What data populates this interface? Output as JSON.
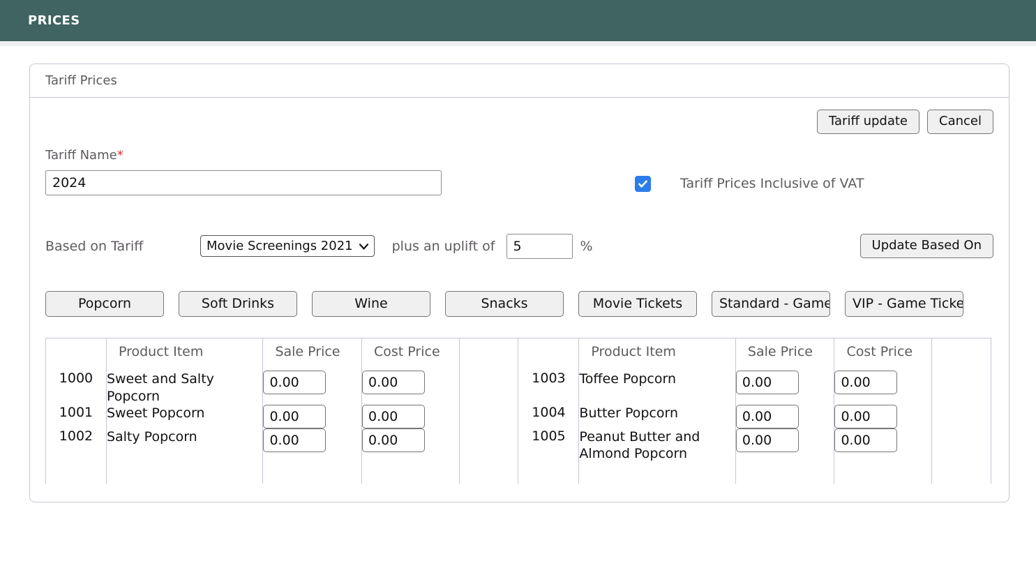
{
  "appbar": {
    "title": "PRICES"
  },
  "panel": {
    "title": "Tariff Prices"
  },
  "toolbar": {
    "tariff_update_label": "Tariff update",
    "cancel_label": "Cancel"
  },
  "form": {
    "tariff_name_label": "Tariff Name",
    "required_marker": "*",
    "tariff_name_value": "2024",
    "vat_label": "Tariff Prices Inclusive of VAT",
    "vat_checked": "true",
    "based_on_label": "Based on Tariff",
    "based_on_value": "Movie Screenings 2021",
    "based_on_chevron": "⌄",
    "uplift_text": "plus an uplift of",
    "uplift_value": "5",
    "percent_symbol": "%",
    "update_based_on_label": "Update Based On"
  },
  "categories": [
    {
      "label": "Popcorn"
    },
    {
      "label": "Soft Drinks"
    },
    {
      "label": "Wine"
    },
    {
      "label": "Snacks"
    },
    {
      "label": "Movie Tickets"
    },
    {
      "label": "Standard - Game Tickets"
    },
    {
      "label": "VIP - Game Tickets"
    }
  ],
  "table": {
    "headers": {
      "product_item": "Product Item",
      "sale_price": "Sale Price",
      "cost_price": "Cost Price"
    },
    "rows": [
      {
        "left": {
          "id": "1000",
          "item": "Sweet and Salty Popcorn",
          "sale": "0.00",
          "cost": "0.00"
        },
        "right": {
          "id": "1003",
          "item": "Toffee Popcorn",
          "sale": "0.00",
          "cost": "0.00"
        }
      },
      {
        "left": {
          "id": "1001",
          "item": "Sweet Popcorn",
          "sale": "0.00",
          "cost": "0.00"
        },
        "right": {
          "id": "1004",
          "item": "Butter Popcorn",
          "sale": "0.00",
          "cost": "0.00"
        }
      },
      {
        "left": {
          "id": "1002",
          "item": "Salty Popcorn",
          "sale": "0.00",
          "cost": "0.00"
        },
        "right": {
          "id": "1005",
          "item": "Peanut Butter and Almond Popcorn",
          "sale": "0.00",
          "cost": "0.00"
        }
      }
    ]
  },
  "colors": {
    "appbar_background": "#3f6462",
    "checkbox_accent": "#2b7de9",
    "required_marker": "#d0342c",
    "panel_border": "#c7c6d8",
    "label_text": "#5e5a5f"
  }
}
